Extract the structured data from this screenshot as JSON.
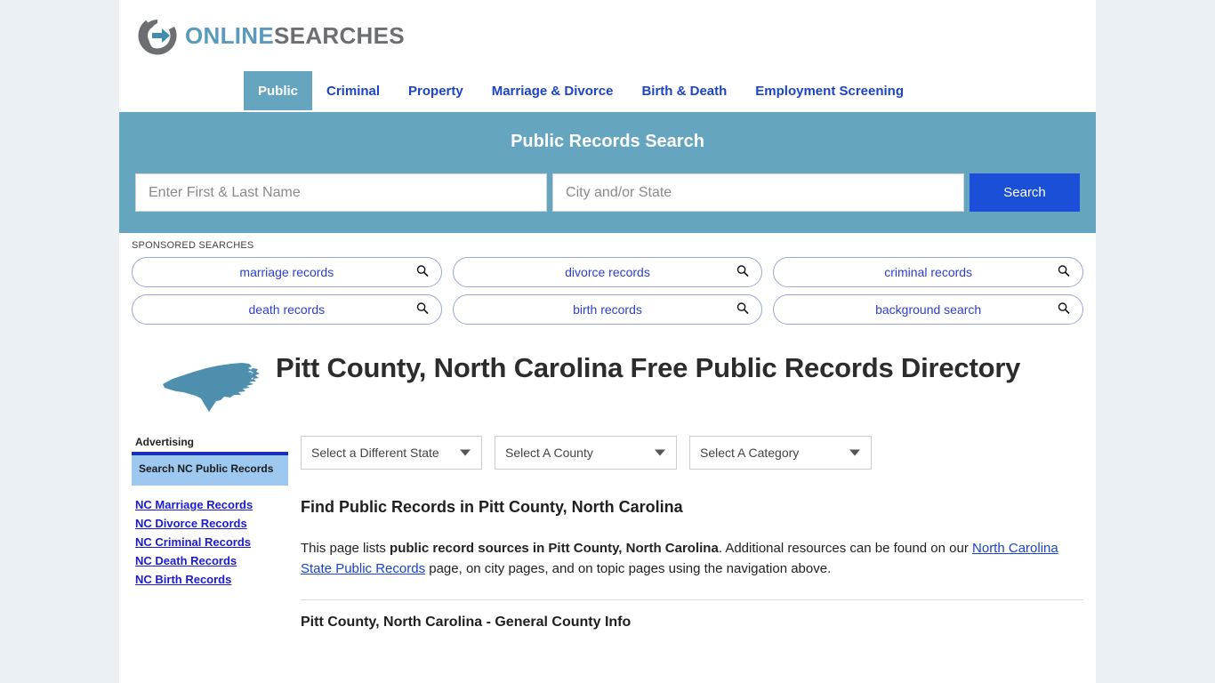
{
  "brand": {
    "name_part1": "ONLINE",
    "name_part2": "SEARCHES",
    "logo_icon": "circle-arrow-icon",
    "accent_blue": "#5a9bbd",
    "accent_grey": "#6d6e71"
  },
  "nav": {
    "items": [
      {
        "label": "Public",
        "active": true
      },
      {
        "label": "Criminal",
        "active": false
      },
      {
        "label": "Property",
        "active": false
      },
      {
        "label": "Marriage & Divorce",
        "active": false
      },
      {
        "label": "Birth & Death",
        "active": false
      },
      {
        "label": "Employment Screening",
        "active": false
      }
    ]
  },
  "search": {
    "title": "Public Records Search",
    "name_placeholder": "Enter First & Last Name",
    "name_value": "",
    "city_placeholder": "City and/or State",
    "city_value": "",
    "button_label": "Search",
    "band_color": "#66a5c0",
    "button_color": "#1b4fd8"
  },
  "sponsored": {
    "label": "SPONSORED SEARCHES",
    "pills": [
      {
        "label": "marriage records",
        "icon": "search-icon"
      },
      {
        "label": "divorce records",
        "icon": "search-icon"
      },
      {
        "label": "criminal records",
        "icon": "search-icon"
      },
      {
        "label": "death records",
        "icon": "search-icon"
      },
      {
        "label": "birth records",
        "icon": "search-icon"
      },
      {
        "label": "background search",
        "icon": "search-icon"
      }
    ]
  },
  "page": {
    "title": "Pitt County, North Carolina Free Public Records Directory",
    "map_icon": "north-carolina-state-map-icon",
    "map_color": "#4e8fae"
  },
  "selects": {
    "state": "Select a Different State",
    "county": "Select A County",
    "category": "Select A Category"
  },
  "content": {
    "heading": "Find Public Records in Pitt County, North Carolina",
    "paragraph_part1": "This page lists ",
    "paragraph_bold": "public record sources in Pitt County, North Carolina",
    "paragraph_part2": ". Additional resources can be found on our ",
    "paragraph_link": "North Carolina State Public Records",
    "paragraph_part3": " page, on city pages, and on topic pages using the navigation above.",
    "section_heading": "Pitt County, North Carolina - General County Info"
  },
  "sidebar": {
    "advertising_label": "Advertising",
    "ad_box_text": "Search NC Public Records",
    "links": [
      {
        "label": "NC Marriage Records"
      },
      {
        "label": "NC Divorce Records"
      },
      {
        "label": "NC Criminal Records"
      },
      {
        "label": "NC Death Records"
      },
      {
        "label": "NC Birth Records"
      }
    ]
  }
}
